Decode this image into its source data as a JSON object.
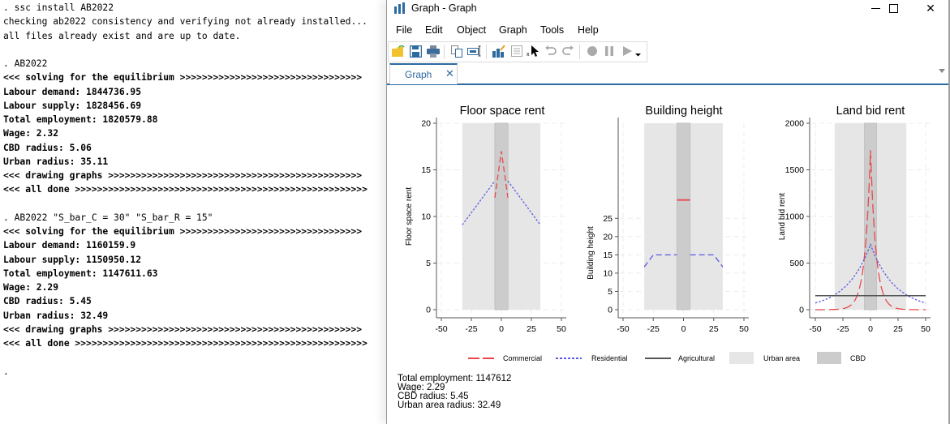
{
  "console": {
    "lines": [
      {
        "text": ". ssc install AB2022",
        "bold": false
      },
      {
        "text": "checking ab2022 consistency and verifying not already installed...",
        "bold": false
      },
      {
        "text": "all files already exist and are up to date.",
        "bold": false
      },
      {
        "text": "",
        "bold": false
      },
      {
        "text": ". AB2022",
        "bold": false
      },
      {
        "text": "<<< solving for the equilibrium >>>>>>>>>>>>>>>>>>>>>>>>>>>>>>>>>",
        "bold": true
      },
      {
        "text": "Labour demand: 1844736.95",
        "bold": true
      },
      {
        "text": "Labour supply: 1828456.69",
        "bold": true
      },
      {
        "text": "Total employment: 1820579.88",
        "bold": true
      },
      {
        "text": "Wage: 2.32",
        "bold": true
      },
      {
        "text": "CBD radius: 5.06",
        "bold": true
      },
      {
        "text": "Urban radius: 35.11",
        "bold": true
      },
      {
        "text": "<<< drawing graphs >>>>>>>>>>>>>>>>>>>>>>>>>>>>>>>>>>>>>>>>>>>>>>",
        "bold": true
      },
      {
        "text": "<<< all done >>>>>>>>>>>>>>>>>>>>>>>>>>>>>>>>>>>>>>>>>>>>>>>>>>>>>",
        "bold": true
      },
      {
        "text": "",
        "bold": false
      },
      {
        "text": ". AB2022 \"S_bar_C = 30\" \"S_bar_R = 15\"",
        "bold": false
      },
      {
        "text": "<<< solving for the equilibrium >>>>>>>>>>>>>>>>>>>>>>>>>>>>>>>>>",
        "bold": true
      },
      {
        "text": "Labour demand: 1160159.9",
        "bold": true
      },
      {
        "text": "Labour supply: 1150950.12",
        "bold": true
      },
      {
        "text": "Total employment: 1147611.63",
        "bold": true
      },
      {
        "text": "Wage: 2.29",
        "bold": true
      },
      {
        "text": "CBD radius: 5.45",
        "bold": true
      },
      {
        "text": "Urban radius: 32.49",
        "bold": true
      },
      {
        "text": "<<< drawing graphs >>>>>>>>>>>>>>>>>>>>>>>>>>>>>>>>>>>>>>>>>>>>>>",
        "bold": true
      },
      {
        "text": "<<< all done >>>>>>>>>>>>>>>>>>>>>>>>>>>>>>>>>>>>>>>>>>>>>>>>>>>>>",
        "bold": true
      },
      {
        "text": "",
        "bold": false
      },
      {
        "text": ".",
        "bold": false
      }
    ]
  },
  "window": {
    "title": "Graph - Graph",
    "icon": "bar-chart-icon",
    "controls": {
      "minimize": "—",
      "maximize": "☐",
      "close": "✕"
    },
    "menu": [
      "File",
      "Edit",
      "Object",
      "Graph",
      "Tools",
      "Help"
    ],
    "toolbar": [
      "open-folder-icon",
      "save-icon",
      "print-icon",
      "copy-icon",
      "rename-icon",
      "graph-editor-icon",
      "object-browser-icon",
      "pointer-icon",
      "undo-icon",
      "redo-icon",
      "record-icon",
      "pause-icon",
      "play-icon",
      "dropdown-icon"
    ],
    "tab": {
      "label": "Graph",
      "close": "✕"
    }
  },
  "colors": {
    "commercial": "#e8484c",
    "residential": "#5a5ae6",
    "agricultural": "#555555",
    "urban_area": "#e6e6e6",
    "cbd": "#cccccc",
    "accent": "#2c6aa0"
  },
  "chart_data": [
    {
      "type": "line",
      "title": "Floor space rent",
      "xlabel": "",
      "ylabel": "Floor space rent",
      "xlim": [
        -50,
        50
      ],
      "ylim": [
        0,
        20
      ],
      "xticks": [
        "-50",
        "-25",
        "0",
        "25",
        "50"
      ],
      "yticks": [
        "0",
        "5",
        "10",
        "15",
        "20"
      ],
      "ytick_values": [
        0,
        5,
        10,
        15,
        20
      ],
      "grid": true,
      "shaded": {
        "urban_area": [
          -32.49,
          32.49
        ],
        "cbd": [
          -5.45,
          5.45
        ]
      },
      "series": [
        {
          "name": "Commercial",
          "style": "dash",
          "points": [
            [
              -5.45,
              12
            ],
            [
              0,
              17
            ],
            [
              5.45,
              12
            ]
          ]
        },
        {
          "name": "Residential",
          "style": "dot",
          "segments": [
            [
              [
                -32.49,
                9.1
              ],
              [
                -5.45,
                13.8
              ]
            ],
            [
              [
                5.45,
                13.8
              ],
              [
                32.49,
                9.1
              ]
            ]
          ]
        }
      ]
    },
    {
      "type": "line",
      "title": "Building height",
      "xlabel": "",
      "ylabel": "Building height",
      "xlim": [
        -50,
        50
      ],
      "ylim": [
        0,
        51
      ],
      "xticks": [
        "-50",
        "-25",
        "0",
        "25",
        "50"
      ],
      "yticks": [
        "0",
        "5",
        "10",
        "15",
        "20",
        "25"
      ],
      "ytick_values": [
        0,
        5,
        10,
        15,
        20,
        25
      ],
      "grid": true,
      "shaded": {
        "urban_area": [
          -32.49,
          32.49
        ],
        "cbd": [
          -5.45,
          5.45
        ]
      },
      "series": [
        {
          "name": "Commercial",
          "style": "solid",
          "points": [
            [
              -5.45,
              30
            ],
            [
              5.45,
              30
            ]
          ]
        },
        {
          "name": "Residential",
          "style": "dash",
          "segments": [
            [
              [
                -32.49,
                11.7
              ],
              [
                -25,
                15
              ],
              [
                -5.45,
                15
              ]
            ],
            [
              [
                5.45,
                15
              ],
              [
                25,
                15
              ],
              [
                32.49,
                11.7
              ]
            ]
          ]
        }
      ]
    },
    {
      "type": "line",
      "title": "Land bid rent",
      "xlabel": "",
      "ylabel": "Land bid rent",
      "xlim": [
        -50,
        50
      ],
      "ylim": [
        0,
        2000
      ],
      "xticks": [
        "-50",
        "-25",
        "0",
        "25",
        "50"
      ],
      "yticks": [
        "0",
        "500",
        "1000",
        "1500",
        "2000"
      ],
      "ytick_values": [
        0,
        500,
        1000,
        1500,
        2000
      ],
      "grid": true,
      "shaded": {
        "urban_area": [
          -32.49,
          32.49
        ],
        "cbd": [
          -5.45,
          5.45
        ]
      },
      "series": [
        {
          "name": "Commercial",
          "style": "longdash",
          "peak": 1710,
          "decay": 0.2,
          "points_desc": "exponential decay from 1710 at 0 to ~0 at |x|>=25"
        },
        {
          "name": "Residential",
          "style": "dot",
          "peak": 700,
          "decay": 0.0455
        },
        {
          "name": "Agricultural",
          "style": "solid",
          "points": [
            [
              -50,
              150
            ],
            [
              50,
              150
            ]
          ]
        }
      ]
    }
  ],
  "legend": [
    {
      "label": "Commercial",
      "kind": "commercial"
    },
    {
      "label": "Residential",
      "kind": "residential"
    },
    {
      "label": "Agricultural",
      "kind": "agricultural"
    },
    {
      "label": "Urban area",
      "kind": "urban_area"
    },
    {
      "label": "CBD",
      "kind": "cbd"
    }
  ],
  "note": [
    "Total employment: 1147612",
    "Wage: 2.29",
    "CBD radius: 5.45",
    "Urban area radius: 32.49"
  ]
}
